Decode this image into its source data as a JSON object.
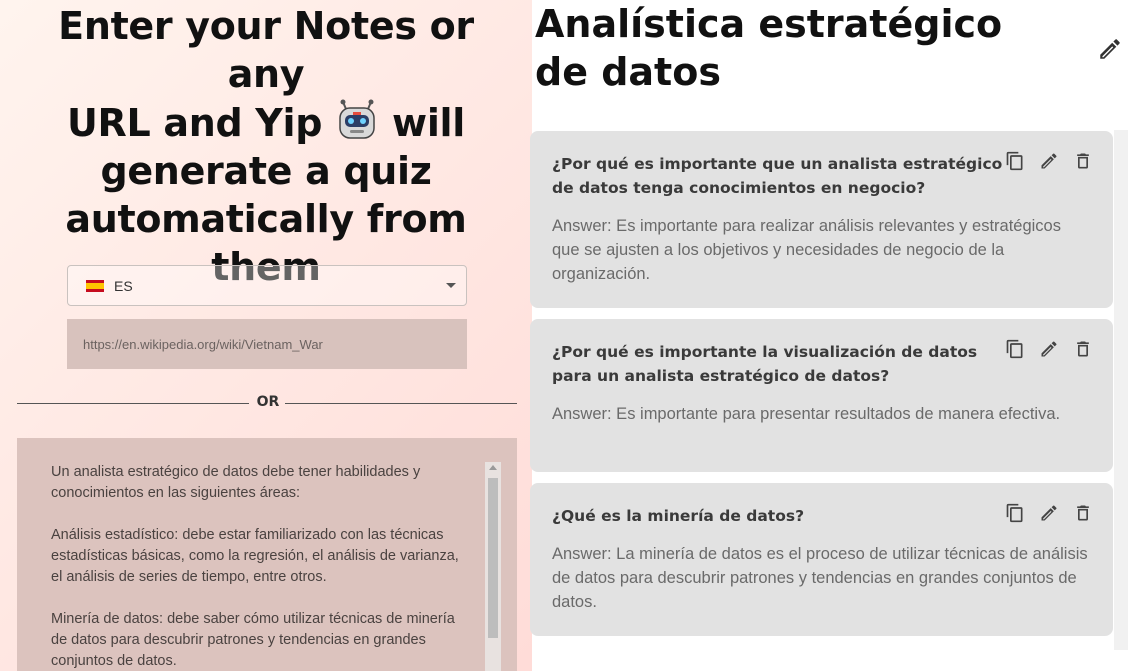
{
  "hero": {
    "line1": "Enter your Notes or any",
    "line2_before": "URL and Yip",
    "line2_after": "will",
    "line3": "generate a quiz",
    "line4": "automatically from",
    "line5": "them",
    "robot_icon": "robot-emoji"
  },
  "language_select": {
    "value": "ES",
    "flag_icon": "spain-flag-icon"
  },
  "url_input": {
    "placeholder": "https://en.wikipedia.org/wiki/Vietnam_War"
  },
  "divider": {
    "label": "OR"
  },
  "notes": {
    "text": "Un analista estratégico de datos debe tener habilidades y conocimientos en las siguientes áreas:\n\nAnálisis estadístico: debe estar familiarizado con las técnicas estadísticas básicas, como la regresión, el análisis de varianza, el análisis de series de tiempo, entre otros.\n\nMinería de datos: debe saber cómo utilizar técnicas de minería de datos para descubrir patrones y tendencias en grandes conjuntos de datos."
  },
  "quiz": {
    "title_line1": "Analística estratégico",
    "title_line2": "de datos",
    "cards": [
      {
        "question": "¿Por qué es importante que un analista estratégico de datos tenga conocimientos en negocio?",
        "answer": "Answer: Es importante para realizar análisis relevantes y estratégicos que se ajusten a los objetivos y necesidades de negocio de la organización."
      },
      {
        "question": "¿Por qué es importante la visualización de datos para un analista estratégico de datos?",
        "answer": "Answer: Es importante para presentar resultados de manera efectiva."
      },
      {
        "question": "¿Qué es la minería de datos?",
        "answer": "Answer: La minería de datos es el proceso de utilizar técnicas de análisis de datos para descubrir patrones y tendencias en grandes conjuntos de datos."
      }
    ]
  },
  "colors": {
    "card_bg": "#e2e2e2",
    "notes_bg": "#dcc3be",
    "url_bg": "#d8c2bd"
  }
}
